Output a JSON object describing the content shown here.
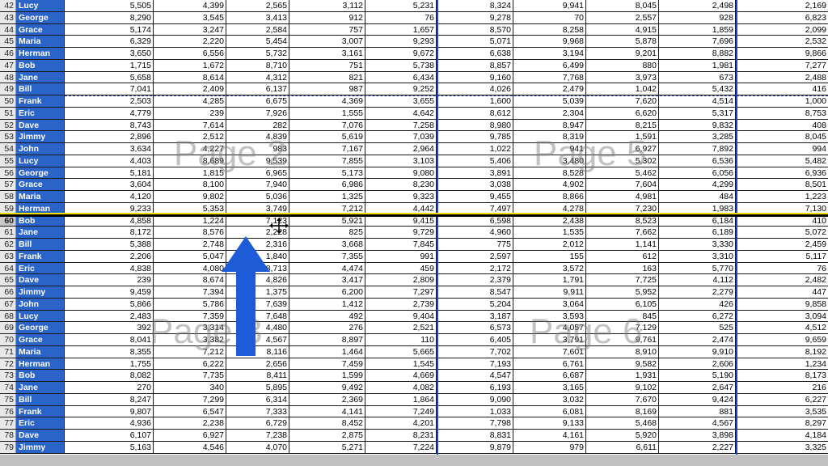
{
  "sheet": {
    "rows": [
      {
        "num": "42",
        "name": "Lucy",
        "values": [
          "5,505",
          "4,399",
          "2,565",
          "3,112",
          "5,231",
          "8,324",
          "9,941",
          "8,045",
          "2,498",
          "2,169"
        ]
      },
      {
        "num": "43",
        "name": "George",
        "values": [
          "8,290",
          "3,545",
          "3,413",
          "912",
          "76",
          "9,278",
          "70",
          "2,557",
          "928",
          "6,823"
        ]
      },
      {
        "num": "44",
        "name": "Grace",
        "values": [
          "5,174",
          "3,247",
          "2,584",
          "757",
          "1,657",
          "8,570",
          "8,258",
          "4,915",
          "1,859",
          "2,099"
        ]
      },
      {
        "num": "45",
        "name": "Maria",
        "values": [
          "6,329",
          "2,220",
          "5,454",
          "3,007",
          "9,293",
          "5,071",
          "9,968",
          "5,878",
          "7,696",
          "2,532"
        ]
      },
      {
        "num": "46",
        "name": "Herman",
        "values": [
          "3,650",
          "6,556",
          "5,732",
          "3,161",
          "9,672",
          "6,638",
          "3,194",
          "9,201",
          "8,882",
          "9,866"
        ]
      },
      {
        "num": "47",
        "name": "Bob",
        "values": [
          "1,715",
          "1,672",
          "8,710",
          "751",
          "5,738",
          "8,857",
          "6,499",
          "880",
          "1,981",
          "7,277"
        ]
      },
      {
        "num": "48",
        "name": "Jane",
        "values": [
          "5,658",
          "8,614",
          "4,312",
          "821",
          "6,434",
          "9,160",
          "7,768",
          "3,973",
          "673",
          "2,488"
        ]
      },
      {
        "num": "49",
        "name": "Bill",
        "values": [
          "7,041",
          "2,409",
          "6,137",
          "987",
          "9,252",
          "4,026",
          "2,479",
          "1,042",
          "5,432",
          "416"
        ]
      },
      {
        "num": "50",
        "name": "Frank",
        "values": [
          "2,503",
          "4,285",
          "6,675",
          "4,369",
          "3,655",
          "1,600",
          "5,039",
          "7,620",
          "4,514",
          "1,000"
        ]
      },
      {
        "num": "51",
        "name": "Eric",
        "values": [
          "4,779",
          "239",
          "7,926",
          "1,555",
          "4,642",
          "8,612",
          "2,304",
          "6,620",
          "5,317",
          "8,753"
        ]
      },
      {
        "num": "52",
        "name": "Dave",
        "values": [
          "8,743",
          "7,614",
          "282",
          "7,076",
          "7,258",
          "8,980",
          "8,947",
          "8,215",
          "9,832",
          "408"
        ]
      },
      {
        "num": "53",
        "name": "Jimmy",
        "values": [
          "2,896",
          "2,512",
          "4,839",
          "5,619",
          "7,039",
          "9,785",
          "8,319",
          "1,591",
          "3,285",
          "8,045"
        ]
      },
      {
        "num": "54",
        "name": "John",
        "values": [
          "3,634",
          "4,227",
          "983",
          "7,167",
          "2,964",
          "1,022",
          "941",
          "6,927",
          "7,892",
          "994"
        ]
      },
      {
        "num": "55",
        "name": "Lucy",
        "values": [
          "4,403",
          "8,689",
          "9,539",
          "7,855",
          "3,103",
          "5,406",
          "3,480",
          "5,302",
          "6,536",
          "5,482"
        ]
      },
      {
        "num": "56",
        "name": "George",
        "values": [
          "5,181",
          "1,815",
          "6,965",
          "5,173",
          "9,080",
          "3,891",
          "8,528",
          "5,462",
          "6,056",
          "6,936"
        ]
      },
      {
        "num": "57",
        "name": "Grace",
        "values": [
          "3,604",
          "8,100",
          "7,940",
          "6,986",
          "8,230",
          "3,038",
          "4,902",
          "7,604",
          "4,299",
          "8,501"
        ]
      },
      {
        "num": "58",
        "name": "Maria",
        "values": [
          "4,120",
          "9,802",
          "5,036",
          "1,325",
          "9,323",
          "9,455",
          "8,866",
          "4,981",
          "484",
          "1,223"
        ]
      },
      {
        "num": "59",
        "name": "Herman",
        "values": [
          "9,233",
          "5,353",
          "3,749",
          "7,212",
          "4,442",
          "7,497",
          "4,278",
          "7,230",
          "1,983",
          "7,130"
        ]
      },
      {
        "num": "60",
        "name": "Bob",
        "values": [
          "4,858",
          "1,224",
          "7,123",
          "5,921",
          "9,415",
          "6,598",
          "2,438",
          "8,523",
          "6,184",
          "410"
        ]
      },
      {
        "num": "61",
        "name": "Jane",
        "values": [
          "8,172",
          "8,576",
          "2,228",
          "825",
          "9,729",
          "4,960",
          "1,535",
          "7,662",
          "6,189",
          "5,072"
        ]
      },
      {
        "num": "62",
        "name": "Bill",
        "values": [
          "5,388",
          "2,748",
          "2,316",
          "3,668",
          "7,845",
          "775",
          "2,012",
          "1,141",
          "3,330",
          "2,459"
        ]
      },
      {
        "num": "63",
        "name": "Frank",
        "values": [
          "2,206",
          "5,047",
          "1,840",
          "7,355",
          "991",
          "2,597",
          "155",
          "612",
          "3,310",
          "5,117"
        ]
      },
      {
        "num": "64",
        "name": "Eric",
        "values": [
          "4,838",
          "4,080",
          "8,713",
          "4,474",
          "459",
          "2,172",
          "3,572",
          "163",
          "5,770",
          "76"
        ]
      },
      {
        "num": "65",
        "name": "Dave",
        "values": [
          "239",
          "8,674",
          "4,826",
          "3,417",
          "2,809",
          "2,379",
          "1,791",
          "7,725",
          "4,112",
          "2,482"
        ]
      },
      {
        "num": "66",
        "name": "Jimmy",
        "values": [
          "9,459",
          "7,394",
          "1,375",
          "6,200",
          "7,297",
          "8,547",
          "9,911",
          "5,952",
          "2,279",
          "447"
        ]
      },
      {
        "num": "67",
        "name": "John",
        "values": [
          "5,866",
          "5,786",
          "7,639",
          "1,412",
          "2,739",
          "5,204",
          "3,064",
          "6,105",
          "426",
          "9,858"
        ]
      },
      {
        "num": "68",
        "name": "Lucy",
        "values": [
          "2,483",
          "7,359",
          "7,648",
          "492",
          "9,404",
          "3,187",
          "3,593",
          "845",
          "6,272",
          "3,094"
        ]
      },
      {
        "num": "69",
        "name": "George",
        "values": [
          "392",
          "3,314",
          "4,480",
          "276",
          "2,521",
          "6,573",
          "4,057",
          "7,129",
          "525",
          "4,512"
        ]
      },
      {
        "num": "70",
        "name": "Grace",
        "values": [
          "8,041",
          "3,382",
          "4,567",
          "8,897",
          "110",
          "6,405",
          "3,791",
          "9,761",
          "2,474",
          "9,659"
        ]
      },
      {
        "num": "71",
        "name": "Maria",
        "values": [
          "8,355",
          "7,212",
          "8,116",
          "1,464",
          "5,665",
          "7,702",
          "7,601",
          "8,910",
          "9,910",
          "8,192"
        ]
      },
      {
        "num": "72",
        "name": "Herman",
        "values": [
          "1,755",
          "6,222",
          "2,656",
          "7,459",
          "1,545",
          "7,193",
          "6,761",
          "9,582",
          "2,606",
          "1,234"
        ]
      },
      {
        "num": "73",
        "name": "Bob",
        "values": [
          "8,082",
          "7,735",
          "8,411",
          "1,599",
          "4,669",
          "4,547",
          "6,687",
          "1,931",
          "5,190",
          "8,173"
        ]
      },
      {
        "num": "74",
        "name": "Jane",
        "values": [
          "270",
          "340",
          "5,895",
          "9,492",
          "4,082",
          "6,193",
          "3,165",
          "9,102",
          "2,647",
          "216"
        ]
      },
      {
        "num": "75",
        "name": "Bill",
        "values": [
          "8,247",
          "7,299",
          "6,314",
          "2,369",
          "1,864",
          "9,090",
          "3,032",
          "7,670",
          "9,424",
          "6,227"
        ]
      },
      {
        "num": "76",
        "name": "Frank",
        "values": [
          "9,807",
          "6,547",
          "7,333",
          "4,141",
          "7,249",
          "1,033",
          "6,081",
          "8,169",
          "881",
          "3,535"
        ]
      },
      {
        "num": "77",
        "name": "Eric",
        "values": [
          "4,936",
          "2,238",
          "6,729",
          "8,452",
          "4,201",
          "7,798",
          "9,133",
          "5,468",
          "4,567",
          "8,297"
        ]
      },
      {
        "num": "78",
        "name": "Dave",
        "values": [
          "6,107",
          "6,927",
          "7,238",
          "2,875",
          "8,231",
          "8,831",
          "4,161",
          "5,920",
          "3,898",
          "4,184"
        ]
      },
      {
        "num": "79",
        "name": "Jimmy",
        "values": [
          "5,163",
          "4,546",
          "4,070",
          "5,271",
          "7,224",
          "9,879",
          "979",
          "6,611",
          "2,227",
          "3,325"
        ]
      }
    ],
    "selected_row": "60"
  },
  "watermarks": {
    "page2": "Page 2",
    "page3": "Page 3",
    "page5": "Page 5",
    "page6": "Page 6"
  },
  "colors": {
    "name_column": "#2a64c8",
    "page_break": "#2244cc",
    "arrow": "#1e5bd6",
    "highlight_line": "#f0e000"
  },
  "icons": {
    "arrow": "up-arrow-icon",
    "cursor": "move-cursor-icon"
  }
}
